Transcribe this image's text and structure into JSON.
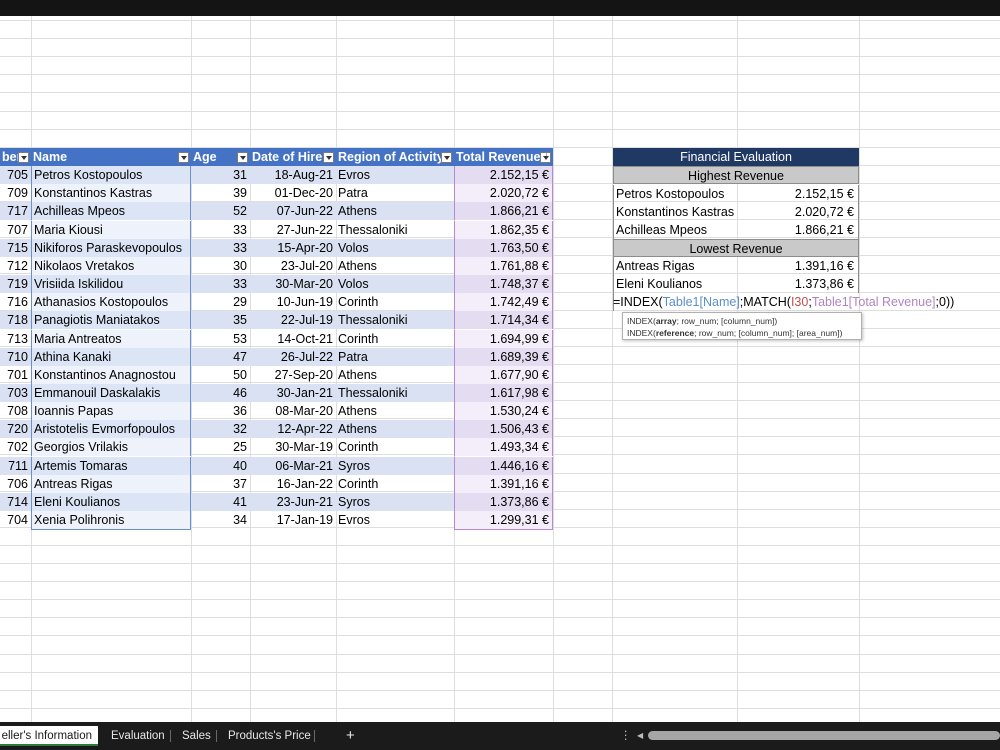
{
  "table": {
    "headers": [
      "ber",
      "Name",
      "Age",
      "Date of Hire",
      "Region of Activity",
      "Total Revenue"
    ],
    "rows": [
      [
        "705",
        "Petros Kostopoulos",
        "31",
        "18-Aug-21",
        "Evros",
        "2.152,15 €"
      ],
      [
        "709",
        "Konstantinos Kastras",
        "39",
        "01-Dec-20",
        "Patra",
        "2.020,72 €"
      ],
      [
        "717",
        "Achilleas Mpeos",
        "52",
        "07-Jun-22",
        "Athens",
        "1.866,21 €"
      ],
      [
        "707",
        "Maria Kiousi",
        "33",
        "27-Jun-22",
        "Thessaloniki",
        "1.862,35 €"
      ],
      [
        "715",
        "Nikiforos Paraskevopoulos",
        "33",
        "15-Apr-20",
        "Volos",
        "1.763,50 €"
      ],
      [
        "712",
        "Nikolaos Vretakos",
        "30",
        "23-Jul-20",
        "Athens",
        "1.761,88 €"
      ],
      [
        "719",
        "Vrisiida Iskilidou",
        "33",
        "30-Mar-20",
        "Volos",
        "1.748,37 €"
      ],
      [
        "716",
        "Athanasios Kostopoulos",
        "29",
        "10-Jun-19",
        "Corinth",
        "1.742,49 €"
      ],
      [
        "718",
        "Panagiotis Maniatakos",
        "35",
        "22-Jul-19",
        "Thessaloniki",
        "1.714,34 €"
      ],
      [
        "713",
        "Maria Antreatos",
        "53",
        "14-Oct-21",
        "Corinth",
        "1.694,99 €"
      ],
      [
        "710",
        "Athina Kanaki",
        "47",
        "26-Jul-22",
        "Patra",
        "1.689,39 €"
      ],
      [
        "701",
        "Konstantinos Anagnostou",
        "50",
        "27-Sep-20",
        "Athens",
        "1.677,90 €"
      ],
      [
        "703",
        "Emmanouil Daskalakis",
        "46",
        "30-Jan-21",
        "Thessaloniki",
        "1.617,98 €"
      ],
      [
        "708",
        "Ioannis Papas",
        "36",
        "08-Mar-20",
        "Athens",
        "1.530,24 €"
      ],
      [
        "720",
        "Aristotelis Evmorfopoulos",
        "32",
        "12-Apr-22",
        "Athens",
        "1.506,43 €"
      ],
      [
        "702",
        "Georgios Vrilakis",
        "25",
        "30-Mar-19",
        "Corinth",
        "1.493,34 €"
      ],
      [
        "711",
        "Artemis Tomaras",
        "40",
        "06-Mar-21",
        "Syros",
        "1.446,16 €"
      ],
      [
        "706",
        "Antreas Rigas",
        "37",
        "16-Jan-22",
        "Corinth",
        "1.391,16 €"
      ],
      [
        "714",
        "Eleni Koulianos",
        "41",
        "23-Jun-21",
        "Syros",
        "1.373,86 €"
      ],
      [
        "704",
        "Xenia Polihronis",
        "34",
        "17-Jan-19",
        "Evros",
        "1.299,31 €"
      ]
    ]
  },
  "evaluation": {
    "title": "Financial Evaluation",
    "highest_label": "Highest Revenue",
    "highest": [
      [
        "Petros Kostopoulos",
        "2.152,15 €"
      ],
      [
        "Konstantinos Kastras",
        "2.020,72 €"
      ],
      [
        "Achilleas Mpeos",
        "1.866,21 €"
      ]
    ],
    "lowest_label": "Lowest Revenue",
    "lowest": [
      [
        "Antreas Rigas",
        "1.391,16 €"
      ],
      [
        "Eleni Koulianos",
        "1.373,86 €"
      ]
    ]
  },
  "formula": {
    "p1": "=INDEX(",
    "ref1": "Table1[Name]",
    "p2": ";MATCH(",
    "ref2": "I30",
    "p3": ";",
    "ref3": "Table1[Total Revenue]",
    "p4": ";0))"
  },
  "tooltip": {
    "line1_fn": "INDEX(",
    "line1_bold": "array",
    "line1_rest": "; row_num; [column_num])",
    "line2_fn": "INDEX(",
    "line2_bold": "reference",
    "line2_rest": "; row_num; [column_num]; [area_num])"
  },
  "sheet_tabs": [
    "eller's Information",
    "Evaluation",
    "Sales",
    "Products's Price"
  ],
  "add_sheet_label": "+",
  "colors": {
    "header": "#4472c4",
    "band": "#d9e1f2",
    "eval_title": "#203864"
  }
}
